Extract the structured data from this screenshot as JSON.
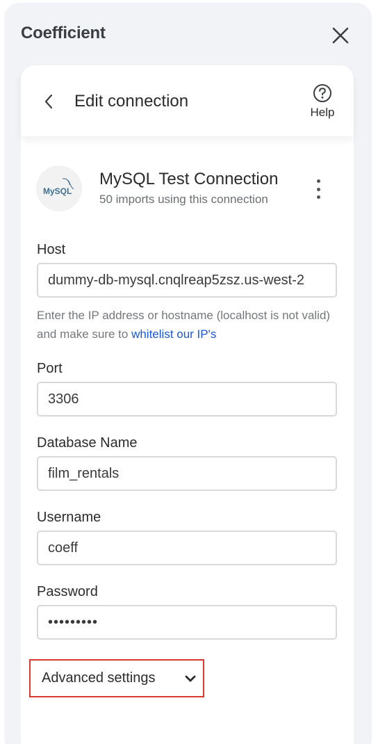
{
  "app": {
    "title": "Coefficient"
  },
  "header": {
    "title": "Edit connection",
    "help_label": "Help"
  },
  "connection": {
    "name": "MySQL Test Connection",
    "subtitle": "50 imports using this connection",
    "logo_text": "MySQL"
  },
  "fields": {
    "host": {
      "label": "Host",
      "value": "dummy-db-mysql.cnqlreap5zsz.us-west-2"
    },
    "hint": {
      "text": "Enter the IP address or hostname (localhost is not valid) and make sure to ",
      "link": "whitelist our IP's"
    },
    "port": {
      "label": "Port",
      "value": "3306"
    },
    "database": {
      "label": "Database Name",
      "value": "film_rentals"
    },
    "username": {
      "label": "Username",
      "value": "coeff"
    },
    "password": {
      "label": "Password",
      "value": "•••••••••"
    }
  },
  "advanced": {
    "label": "Advanced settings"
  },
  "icons": {
    "close": "close-icon",
    "back": "chevron-left-icon",
    "help": "question-circle-icon",
    "menu": "kebab-menu-icon",
    "expand": "chevron-down-icon"
  },
  "colors": {
    "panel_bg": "#f1f3f7",
    "link": "#1a56db",
    "highlight_border": "#d93a2b"
  }
}
